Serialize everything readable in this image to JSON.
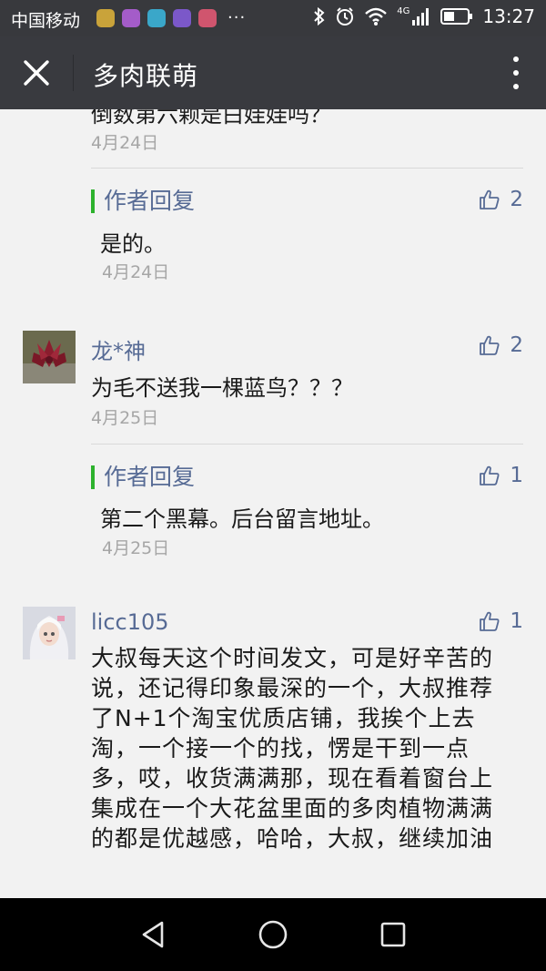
{
  "status_bar": {
    "carrier": "中国移动",
    "network": "4G",
    "time": "13:27",
    "app_icon_colors": [
      "#c9a33a",
      "#a45cc9",
      "#3aa7c9",
      "#7b58c9",
      "#d0556e"
    ],
    "overflow": "···"
  },
  "header": {
    "title": "多肉联萌"
  },
  "comments": {
    "cut_text": "倒数第六颗是白娃娃吗？",
    "cut_date": "4月24日",
    "reply1": {
      "tag": "作者回复",
      "text": "是的。",
      "date": "4月24日",
      "likes": "2"
    },
    "c2": {
      "name": "龙*神",
      "text": "为毛不送我一棵蓝鸟？？？",
      "date": "4月25日",
      "likes": "2"
    },
    "reply2": {
      "tag": "作者回复",
      "text": "第二个黑幕。后台留言地址。",
      "date": "4月25日",
      "likes": "1"
    },
    "c3": {
      "name": "licc105",
      "likes": "1",
      "text": "大叔每天这个时间发文，可是好辛苦的说，还记得印象最深的一个，大叔推荐了N+1个淘宝优质店铺，我挨个上去淘，一个接一个的找，愣是干到一点多，哎，收货满满那，现在看着窗台上集成在一个大花盆里面的多肉植物满满的都是优越感，哈哈，大叔，继续加油"
    }
  },
  "colors": {
    "link": "#576b95",
    "reply_bar": "#2db22d",
    "header_bg": "#393a3f",
    "status_bg": "#38393d"
  }
}
